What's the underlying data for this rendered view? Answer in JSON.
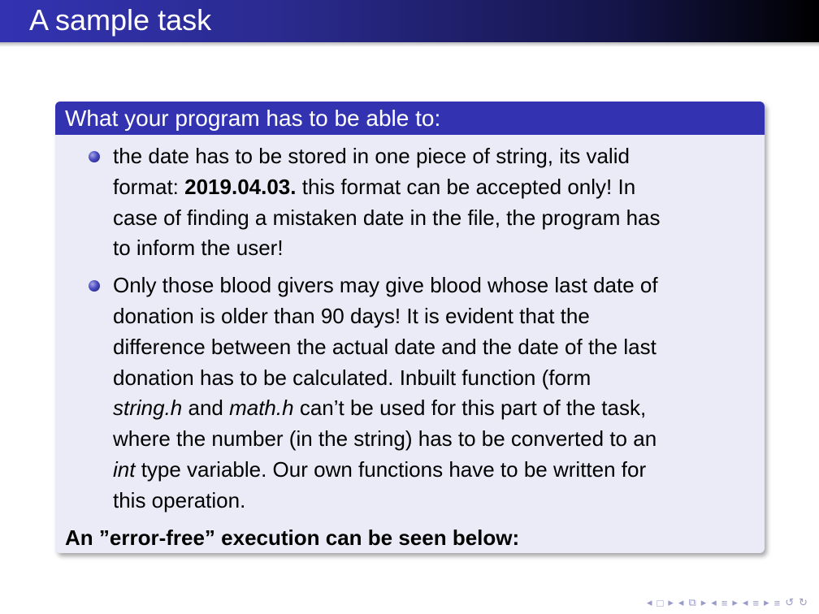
{
  "slide": {
    "title": "A sample task"
  },
  "block": {
    "header": "What your program has to be able to:",
    "item1": {
      "l1": "the date has to be stored in one piece of string, its valid",
      "l2_pre": "format: ",
      "l2_bold": "2019.04.03.",
      "l2_post": " this format can be accepted only! In",
      "l3": "case of finding a mistaken date in the file, the program has",
      "l4": "to inform the user!"
    },
    "item2": {
      "l1": "Only those blood givers may give blood whose last date of",
      "l2": "donation is older than 90 days! It is evident that the",
      "l3": "difference between the actual date and the date of the last",
      "l4": "donation has to be calculated. Inbuilt function (form",
      "l5_it1": "string.h",
      "l5_mid": " and ",
      "l5_it2": "math.h",
      "l5_post": " can’t be used for this part of the task,",
      "l6": "where the number (in the string) has to be converted to an",
      "l7_it": "int",
      "l7_post": " type variable. Our own functions have to be written for",
      "l8": "this operation."
    },
    "footer": "An ”error-free” execution can be seen below:"
  },
  "nav": {
    "icons": [
      "◂",
      "□",
      "▸",
      "◂",
      "⧉",
      "▸",
      "◂",
      "≡",
      "▸",
      "◂",
      "≡",
      "▸",
      "≡",
      "↺",
      "↻"
    ]
  }
}
